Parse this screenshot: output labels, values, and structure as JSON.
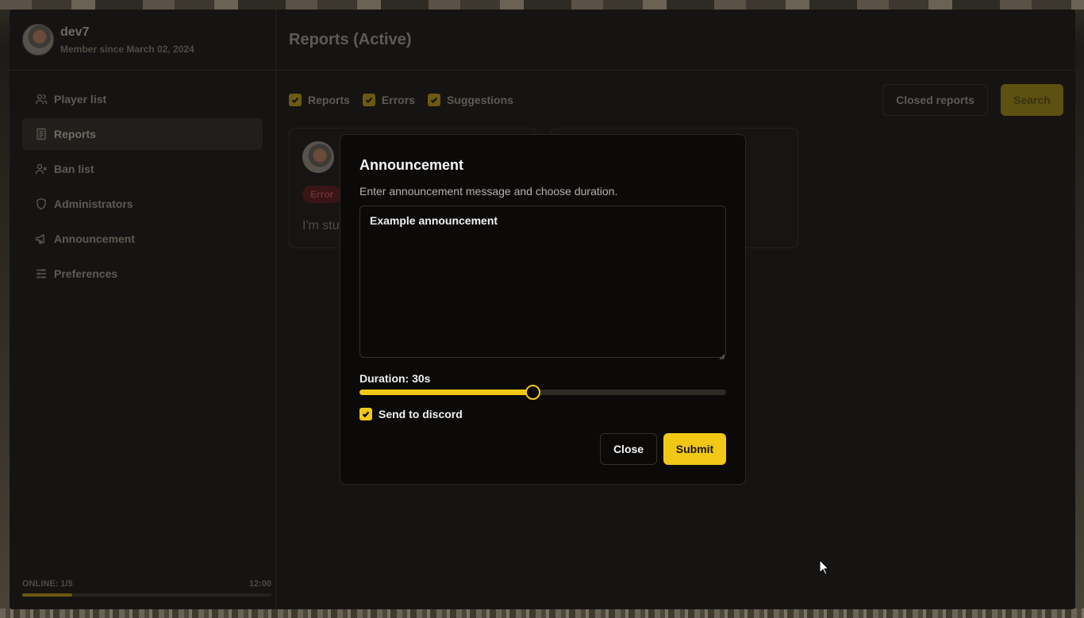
{
  "profile": {
    "name": "dev7",
    "member_since": "Member since March 02, 2024"
  },
  "sidebar": {
    "items": [
      {
        "label": "Player list",
        "icon": "users-icon",
        "active": false
      },
      {
        "label": "Reports",
        "icon": "document-icon",
        "active": true
      },
      {
        "label": "Ban list",
        "icon": "user-x-icon",
        "active": false
      },
      {
        "label": "Administrators",
        "icon": "shield-icon",
        "active": false
      },
      {
        "label": "Announcement",
        "icon": "megaphone-icon",
        "active": false
      },
      {
        "label": "Preferences",
        "icon": "sliders-icon",
        "active": false
      }
    ],
    "footer": {
      "online_label": "ONLINE: 1/5",
      "time": "12:00",
      "online_fraction": 0.2
    }
  },
  "main": {
    "title": "Reports (Active)",
    "filters": [
      {
        "label": "Reports",
        "checked": true
      },
      {
        "label": "Errors",
        "checked": true
      },
      {
        "label": "Suggestions",
        "checked": true
      }
    ],
    "closed_reports_label": "Closed reports",
    "search_label": "Search",
    "card": {
      "badge": "Error",
      "text": "I'm stu"
    }
  },
  "modal": {
    "title": "Announcement",
    "description": "Enter announcement message and choose duration.",
    "message": "Example announcement",
    "duration_label": "Duration: 30s",
    "duration_fraction": 0.474,
    "send_to_discord_label": "Send to discord",
    "send_to_discord_checked": true,
    "close_label": "Close",
    "submit_label": "Submit"
  },
  "colors": {
    "accent": "#f2c817",
    "background": "#161412",
    "modal_background": "#0b0a09"
  }
}
